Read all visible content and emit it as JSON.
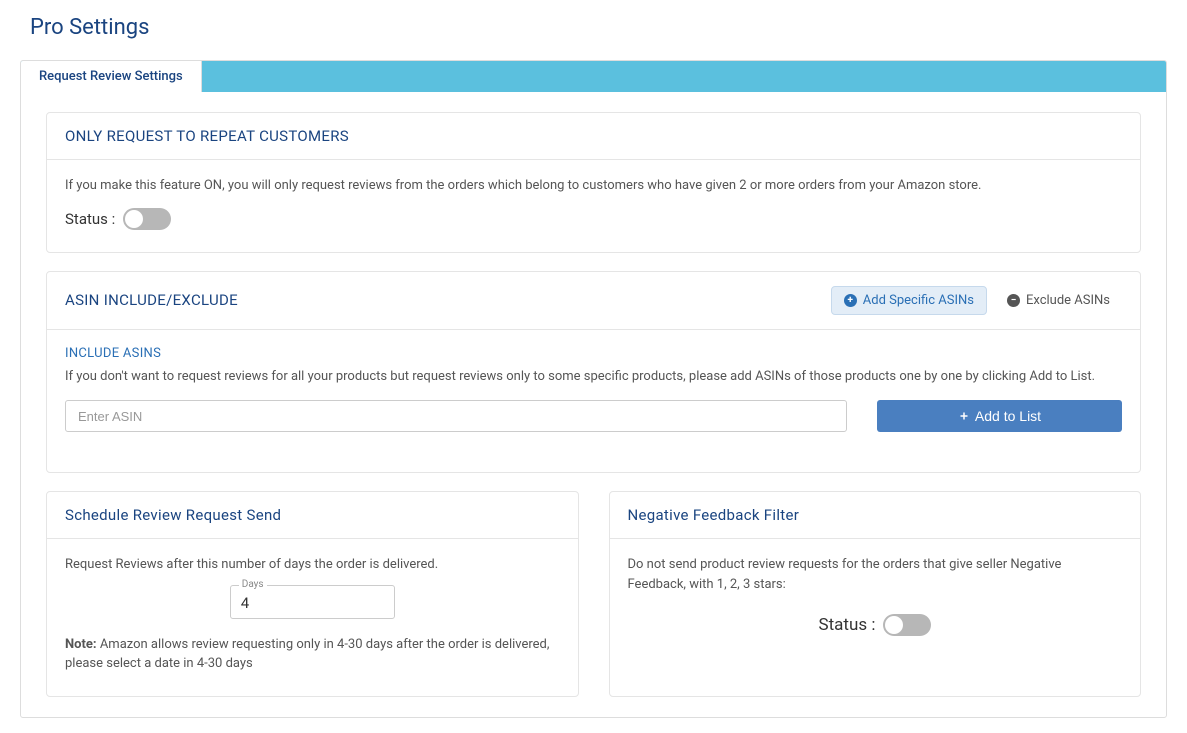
{
  "page": {
    "title": "Pro Settings"
  },
  "tabs": {
    "request_review": "Request Review Settings"
  },
  "repeat_customers": {
    "title": "ONLY REQUEST TO REPEAT CUSTOMERS",
    "description": "If you make this feature ON, you will only request reviews from the orders which belong to customers who have given 2 or more orders from your Amazon store.",
    "status_label": "Status :"
  },
  "asin": {
    "title": "ASIN INCLUDE/EXCLUDE",
    "add_specific": "Add Specific ASINs",
    "exclude": "Exclude ASINs",
    "include_heading": "INCLUDE ASINS",
    "include_desc": "If you don't want to request reviews for all your products but request reviews only to some specific products, please add ASINs of those products one by one by clicking Add to List.",
    "input_placeholder": "Enter ASIN",
    "add_button": "Add to List"
  },
  "schedule": {
    "title": "Schedule Review Request Send",
    "description": "Request Reviews after this number of days the order is delivered.",
    "days_label": "Days",
    "days_value": "4",
    "note_prefix": "Note:",
    "note_text": " Amazon allows review requesting only in 4-30 days after the order is delivered, please select a date in 4-30 days"
  },
  "negative": {
    "title": "Negative Feedback Filter",
    "description": "Do not send product review requests for the orders that give seller Negative Feedback, with 1, 2, 3 stars:",
    "status_label": "Status :"
  }
}
